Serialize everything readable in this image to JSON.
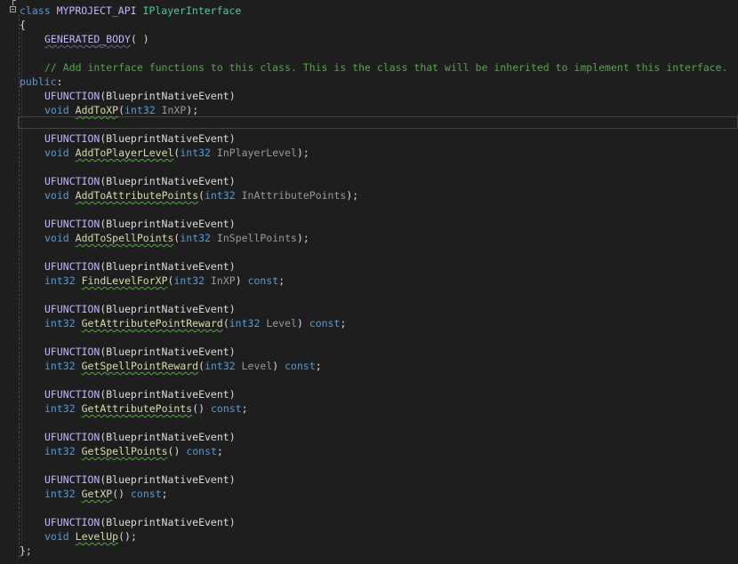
{
  "editor": {
    "class_decl": {
      "keyword": "class",
      "api_macro": "MYPROJECT_API",
      "class_name": "IPlayerInterface"
    },
    "open_brace": "{",
    "generated_body": "GENERATED_BODY",
    "generated_parens": "( )",
    "comment": "// Add interface functions to this class. This is the class that will be inherited to implement this interface.",
    "access": "public",
    "access_colon": ":",
    "ufunction_macro": "UFUNCTION",
    "ufunction_arg": "(BlueprintNativeEvent)",
    "functions": [
      {
        "ret": "void",
        "name": "AddToXP",
        "params": "(int32 InXP);",
        "param_type": "int32",
        "param_name": "InXP",
        "suffix": ""
      },
      {
        "ret": "void",
        "name": "AddToPlayerLevel",
        "params": "",
        "param_type": "int32",
        "param_name": "InPlayerLevel",
        "suffix": ""
      },
      {
        "ret": "void",
        "name": "AddToAttributePoints",
        "params": "",
        "param_type": "int32",
        "param_name": "InAttributePoints",
        "suffix": ""
      },
      {
        "ret": "void",
        "name": "AddToSpellPoints",
        "params": "",
        "param_type": "int32",
        "param_name": "InSpellPoints",
        "suffix": ""
      },
      {
        "ret": "int32",
        "name": "FindLevelForXP",
        "params": "",
        "param_type": "int32",
        "param_name": "InXP",
        "suffix": "const"
      },
      {
        "ret": "int32",
        "name": "GetAttributePointReward",
        "params": "",
        "param_type": "int32",
        "param_name": "Level",
        "suffix": "const"
      },
      {
        "ret": "int32",
        "name": "GetSpellPointReward",
        "params": "",
        "param_type": "int32",
        "param_name": "Level",
        "suffix": "const"
      },
      {
        "ret": "int32",
        "name": "GetAttributePoints",
        "params": "",
        "param_type": "",
        "param_name": "",
        "suffix": "const"
      },
      {
        "ret": "int32",
        "name": "GetSpellPoints",
        "params": "",
        "param_type": "",
        "param_name": "",
        "suffix": "const"
      },
      {
        "ret": "int32",
        "name": "GetXP",
        "params": "",
        "param_type": "",
        "param_name": "",
        "suffix": "const"
      },
      {
        "ret": "void",
        "name": "LevelUp",
        "params": "",
        "param_type": "",
        "param_name": "",
        "suffix": ""
      }
    ],
    "close_brace": "};"
  },
  "colors": {
    "background": "#1e1e1e",
    "keyword": "#569cd6",
    "macro": "#beb7ff",
    "function": "#dcdcaa",
    "comment": "#57a64a",
    "text": "#dcdcdc"
  }
}
